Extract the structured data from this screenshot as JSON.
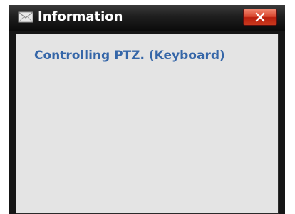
{
  "window": {
    "title": "Information",
    "title_icon": "envelope-icon",
    "close_icon": "close-icon"
  },
  "content": {
    "message": "Controlling PTZ. (Keyboard)"
  },
  "colors": {
    "titlebar": "#1e1e1e",
    "title_text": "#ffffff",
    "close_button": "#d6432b",
    "content_background": "#e4e4e4",
    "message_text": "#3566a8"
  }
}
